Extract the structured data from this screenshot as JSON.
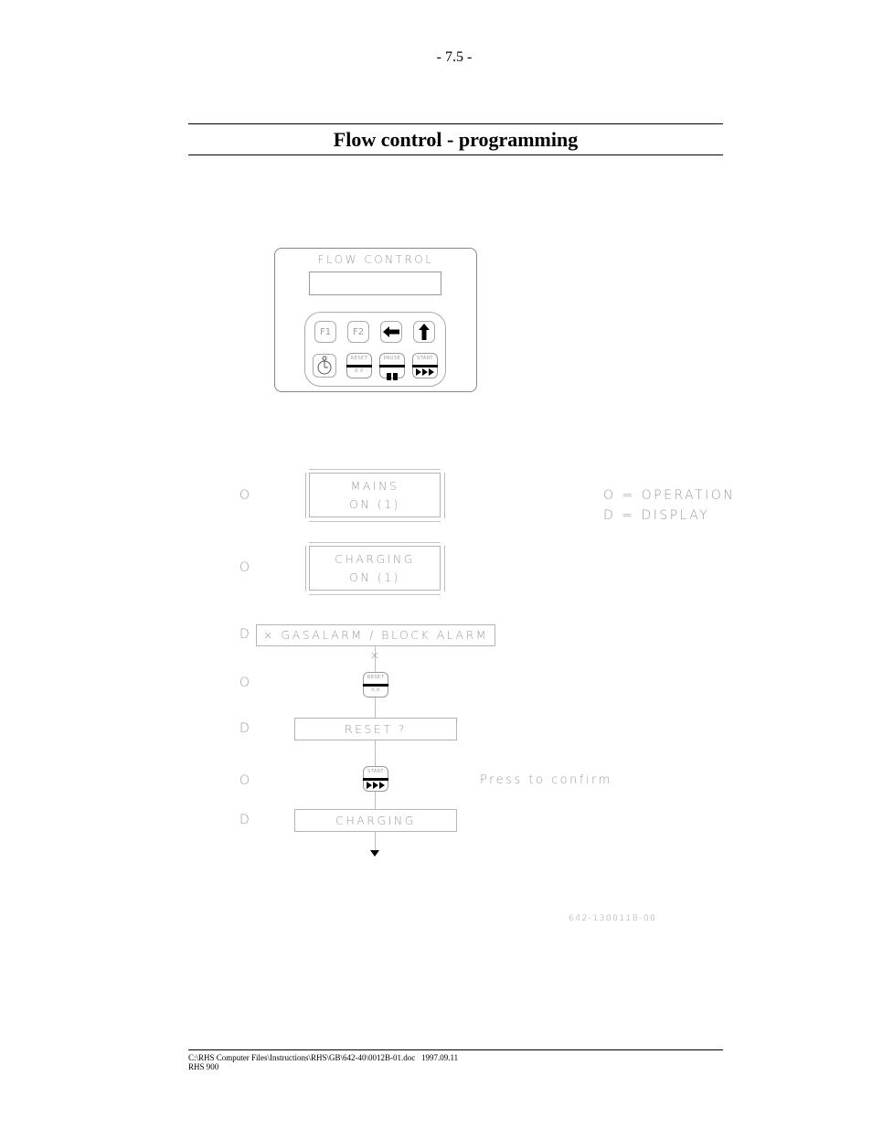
{
  "page": {
    "page_number": "- 7.5 -",
    "title": "Flow control - programming"
  },
  "panel": {
    "title": "FLOW CONTROL",
    "keys": {
      "f1": "F1",
      "f2": "F2",
      "left_arrow": "left-arrow",
      "up_arrow": "up-arrow",
      "timer": "timer",
      "reset_top": "RESET",
      "reset_bottom": "0.0",
      "pause_top": "PAUSE",
      "start_top": "START"
    }
  },
  "legend": {
    "operation": "O = OPERATION",
    "display": "D = DISPLAY"
  },
  "flow": {
    "steps": [
      {
        "marker": "O",
        "line1": "MAINS",
        "line2": "ON (1)"
      },
      {
        "marker": "O",
        "line1": "CHARGING",
        "line2": "ON (1)"
      },
      {
        "marker": "D",
        "text": "× GASALARM / BLOCK ALARM ×"
      },
      {
        "marker": "O",
        "key_top": "RESET",
        "key_bottom": "0.0"
      },
      {
        "marker": "D",
        "text": "RESET ?"
      },
      {
        "marker": "O",
        "key_top": "START",
        "note": "Press to confirm"
      },
      {
        "marker": "D",
        "text": "CHARGING"
      }
    ]
  },
  "drawing_number": "642-130011B-00",
  "footer": {
    "path": "C:\\RHS Computer Files\\Instructions\\RHS\\GB\\642-40\\0012B-01.doc   1997.09.11",
    "product": "RHS 900"
  }
}
